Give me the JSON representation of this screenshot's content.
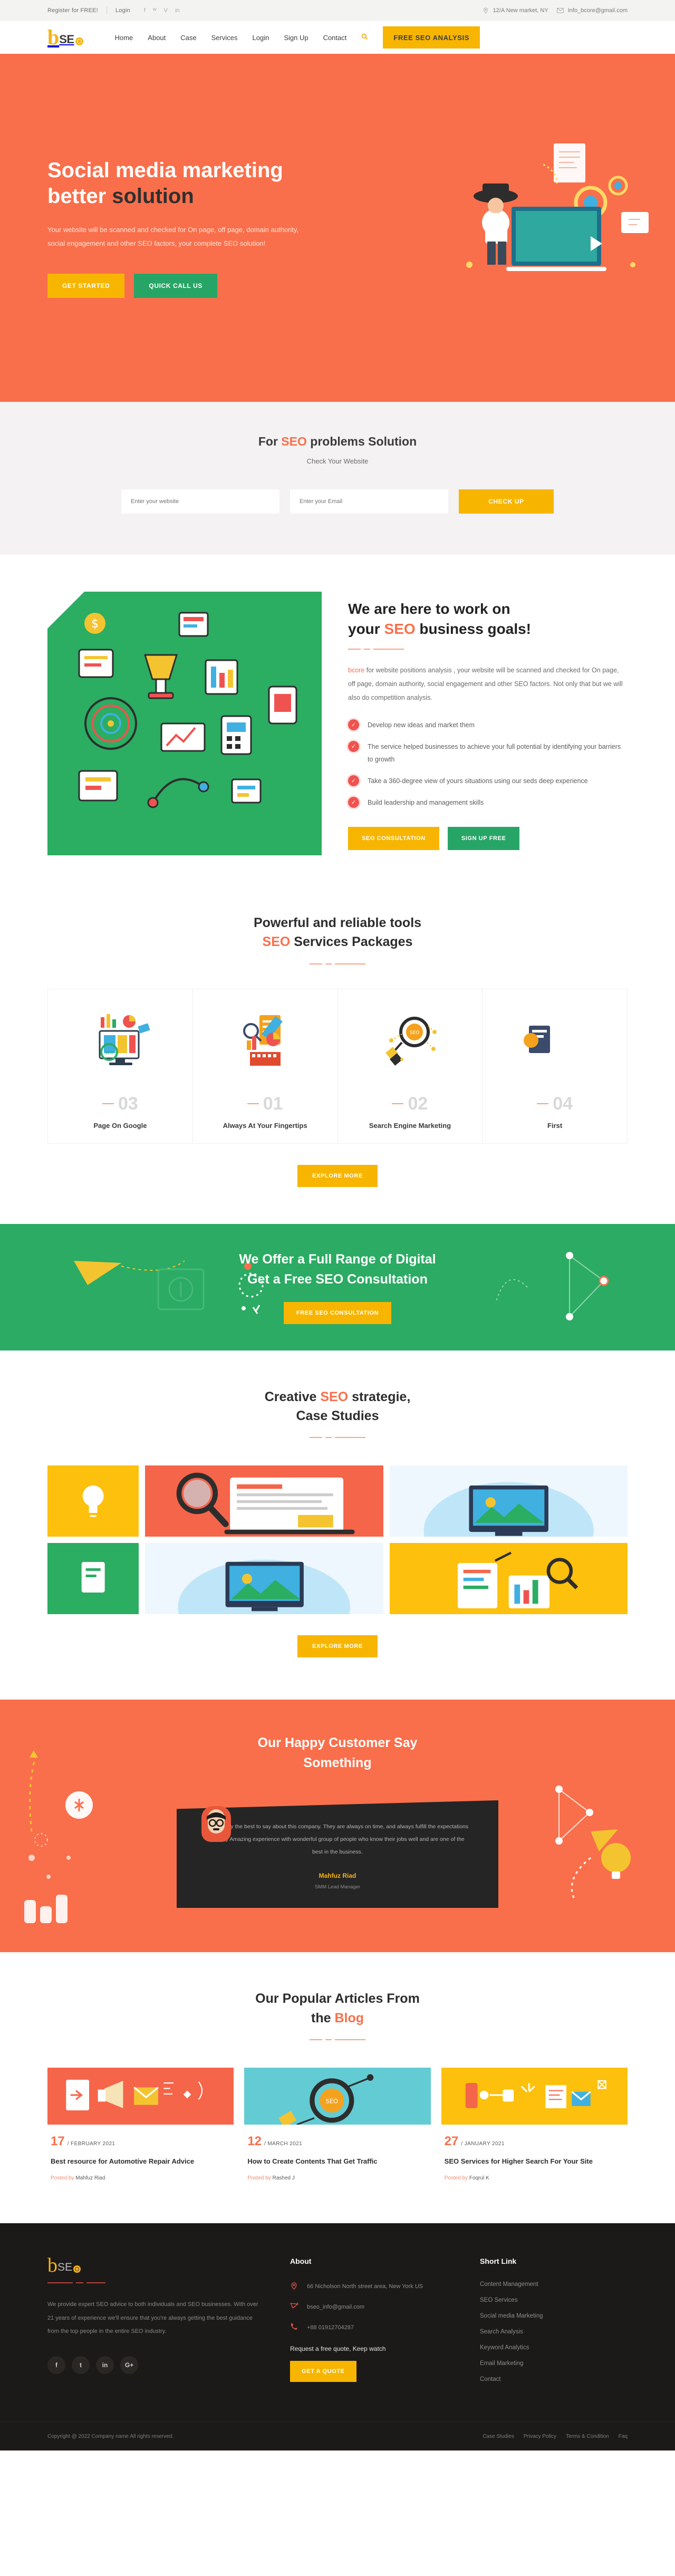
{
  "topbar": {
    "register": "Register for FREE!",
    "login": "Login",
    "socials": [
      "facebook-icon",
      "twitter-icon",
      "vimeo-icon",
      "linkedin-icon"
    ],
    "address": "12/A New market, NY",
    "email": "Info_bcore@gmail.com"
  },
  "brand": {
    "b": "b",
    "se": "SE"
  },
  "nav": {
    "items": [
      "Home",
      "About",
      "Case",
      "Services",
      "Login",
      "Sign Up",
      "Contact"
    ],
    "search_icon": "search-icon",
    "cta": "FREE SEO ANALYSIS"
  },
  "hero": {
    "title_line1": "Social media marketing",
    "title_line2_light": "better ",
    "title_line2_dark": "solution",
    "paragraph": "Your website will be scanned and checked for On page, off page, domain authority, social engagement and other SEO factors, your complete SEO solution!",
    "btn_primary": "GET STARTED",
    "btn_secondary": "QUICK CALL US"
  },
  "checkup": {
    "title_pre": "For ",
    "title_hl": "SEO",
    "title_post": " problems Solution",
    "subtitle": "Check Your Website",
    "website_placeholder": "Enter your website",
    "email_placeholder": "Enter your Email",
    "button": "CHECK UP"
  },
  "goals": {
    "title_line1": "We are here to work on",
    "title_line2_pre": "your ",
    "title_line2_hl": "SEO",
    "title_line2_post": " business goals!",
    "lead_brand": "bcore",
    "lead_rest": " for website positions analysis , your website will be scanned and checked for On page, off page, domain authority, social engagement and other SEO factors. Not only that but we will also do competition analysis.",
    "items": [
      "Develop new ideas and market them",
      "The service helped businesses to achieve your full potential by identifying your barriers to growth",
      "Take a 360-degree view of yours situations using our seds deep experience",
      "Build leadership and management skills"
    ],
    "btn_primary": "SEO CONSULTATION",
    "btn_secondary": "SIGN UP FREE"
  },
  "services": {
    "title_line1": "Powerful and reliable tools",
    "title_line2_hl": "SEO",
    "title_line2_post": " Services Packages",
    "cards": [
      {
        "num": "03",
        "title": "Page On Google"
      },
      {
        "num": "01",
        "title": "Always At Your Fingertips"
      },
      {
        "num": "02",
        "title": "Search Engine Marketing"
      },
      {
        "num": "04",
        "title": "First"
      }
    ],
    "explore": "EXPLORE MORE"
  },
  "green_cta": {
    "line1": "We Offer a Full Range of Digital",
    "line2": "Get a Free SEO Consultation",
    "button": "FREE SEO CONSULTATION"
  },
  "cases": {
    "title_pre": "Creative ",
    "title_hl": "SEO",
    "title_post": " strategie,",
    "title_line2": "Case Studies",
    "explore": "EXPLORE MORE"
  },
  "testimonial": {
    "title_line1": "Our Happy Customer Say",
    "title_line2": "Something",
    "quote": "I have only the best to say about this company. They are always on time, and always fulfill the expectations entirely Amazing experience with wonderful group of people who know their jobs well and are one of the best in the business.",
    "name": "Mahfuz Riad",
    "role": "SMM Lead Manager"
  },
  "blog": {
    "title_line1": "Our Popular Articles From",
    "title_line2_pre": "the ",
    "title_line2_hl": "Blog",
    "posts": [
      {
        "day": "17",
        "month": "/ FEBRUARY 2021",
        "title": "Best resource for Automotive Repair Advice",
        "by": "Posted by ",
        "author": "Mahfuz Riad",
        "color": "#f5654a"
      },
      {
        "day": "12",
        "month": "/ MARCH 2021",
        "title": "How to Create Contents That Get Traffic",
        "by": "Posted by ",
        "author": "Rashed J",
        "color": "#63cbd3"
      },
      {
        "day": "27",
        "month": "/ JANUARY 2021",
        "title": "SEO Services for Higher Search For Your Site",
        "by": "Posted by ",
        "author": "Foqrul K",
        "color": "#fcc00d"
      }
    ]
  },
  "footer": {
    "about_text": "We provide expert SEO advice to both individuals and SEO businesses. With over 21 years of experience we'll ensure that you're always getting the best guidance from the top people in the entire SEO industry.",
    "socials": [
      "f",
      "t",
      "in",
      "G+"
    ],
    "about_heading": "About",
    "address": "66 Nicholson North street area, New York US",
    "email": "bseo_info@gmail.com",
    "phone": "+88 01912704287",
    "quote_text": "Request a free quote, Keep watch",
    "quote_btn": "GET A QUOTE",
    "shortlink_heading": "Short Link",
    "shortlinks": [
      "Content Management",
      "SEO Services",
      "Social media Marketing",
      "Search Analysis",
      "Keyword Analytics",
      "Email Marketing",
      "Contact"
    ],
    "copyright": "Copyright @ 2022 Company name All rights reserved.",
    "bottom_links": [
      "Case Studies",
      "Privacy Policy",
      "Terms & Condition",
      "Faq"
    ]
  },
  "colors": {
    "orange": "#f96f4b",
    "yellow": "#f7b500",
    "green": "#27a567",
    "dark": "#1c1a18"
  }
}
